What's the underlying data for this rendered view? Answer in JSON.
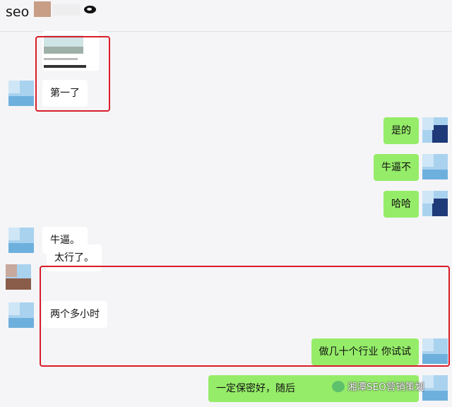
{
  "window": {
    "title": "seo"
  },
  "messages": [
    {
      "side": "left",
      "text": "第一了"
    },
    {
      "side": "right",
      "text": "是的"
    },
    {
      "side": "right",
      "text": "牛逼不"
    },
    {
      "side": "right",
      "text": "哈哈"
    },
    {
      "side": "left",
      "text": "牛逼。"
    },
    {
      "side": "left",
      "text": "太行了。"
    },
    {
      "side": "left",
      "text": "两个多小时"
    },
    {
      "side": "right",
      "text": "做几十个行业 你试试"
    },
    {
      "side": "right",
      "text": "一定保密好，随后"
    }
  ],
  "watermark": {
    "text": "湘潭SEO营销策划"
  },
  "colors": {
    "background": "#f5f5f7",
    "bubble_sent": "#95ec69",
    "bubble_received": "#ffffff",
    "highlight_box": "#d91c2a"
  }
}
